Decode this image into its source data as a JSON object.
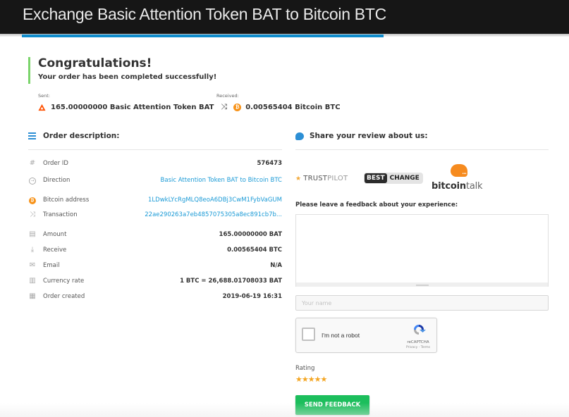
{
  "header": {
    "title": "Exchange Basic Attention Token BAT to Bitcoin BTC",
    "accent_color": "#0f8ccc"
  },
  "status": {
    "title": "Congratulations!",
    "subtitle": "Your order has been completed successfully!",
    "accent_color": "#7bd46b"
  },
  "swap": {
    "sent_label": "Sent:",
    "sent_value": "165.00000000 Basic Attention Token BAT",
    "sent_icon": "bat-icon",
    "swap_icon": "shuffle-icon",
    "received_label": "Received:",
    "received_value": "0.00565404 Bitcoin BTC",
    "received_icon": "bitcoin-icon"
  },
  "order": {
    "heading": "Order description:",
    "rows": [
      {
        "icon": "hash-icon",
        "label": "Order ID",
        "value": "576473",
        "link": false
      },
      {
        "icon": "direction-icon",
        "label": "Direction",
        "value": "Basic Attention Token BAT to Bitcoin BTC",
        "link": true
      },
      {
        "icon": "bitcoin-icon",
        "label": "Bitcoin address",
        "value": "1LDwkLYcRgMLQ8eoA6DBj3CwM1FybVaGUM",
        "link": true
      },
      {
        "icon": "shuffle-icon",
        "label": "Transaction",
        "value": "22ae290263a7eb4857075305a8ec891cb7b...",
        "link": true
      },
      {
        "icon": "wallet-icon",
        "label": "Amount",
        "value": "165.00000000 BAT",
        "link": false
      },
      {
        "icon": "download-icon",
        "label": "Receive",
        "value": "0.00565404 BTC",
        "link": false
      },
      {
        "icon": "email-icon",
        "label": "Email",
        "value": "N/A",
        "link": false
      },
      {
        "icon": "chart-icon",
        "label": "Currency rate",
        "value": "1 BTC = 26,688.01708033 BAT",
        "link": false
      },
      {
        "icon": "calendar-icon",
        "label": "Order created",
        "value": "2019-06-19 16:31",
        "link": false
      }
    ]
  },
  "review": {
    "heading": "Share your review about us:",
    "logos": {
      "trustpilot_a": "TRUST",
      "trustpilot_b": "PILOT",
      "bestchange_a": "BEST",
      "bestchange_b": "CHANGE",
      "bitcointalk_a": "bitcoin",
      "bitcointalk_b": "talk"
    },
    "feedback_label": "Please leave a feedback about your experience:",
    "feedback_value": "",
    "name_placeholder": "Your name",
    "name_value": "",
    "captcha": {
      "label": "I'm not a robot",
      "brand": "reCAPTCHA",
      "terms": "Privacy - Terms",
      "checked": false
    },
    "rating_label": "Rating",
    "rating": 5,
    "rating_max": 5,
    "star_color": "#f4a623",
    "submit_label": "SEND FEEDBACK",
    "submit_color": "#1cbe5c"
  }
}
